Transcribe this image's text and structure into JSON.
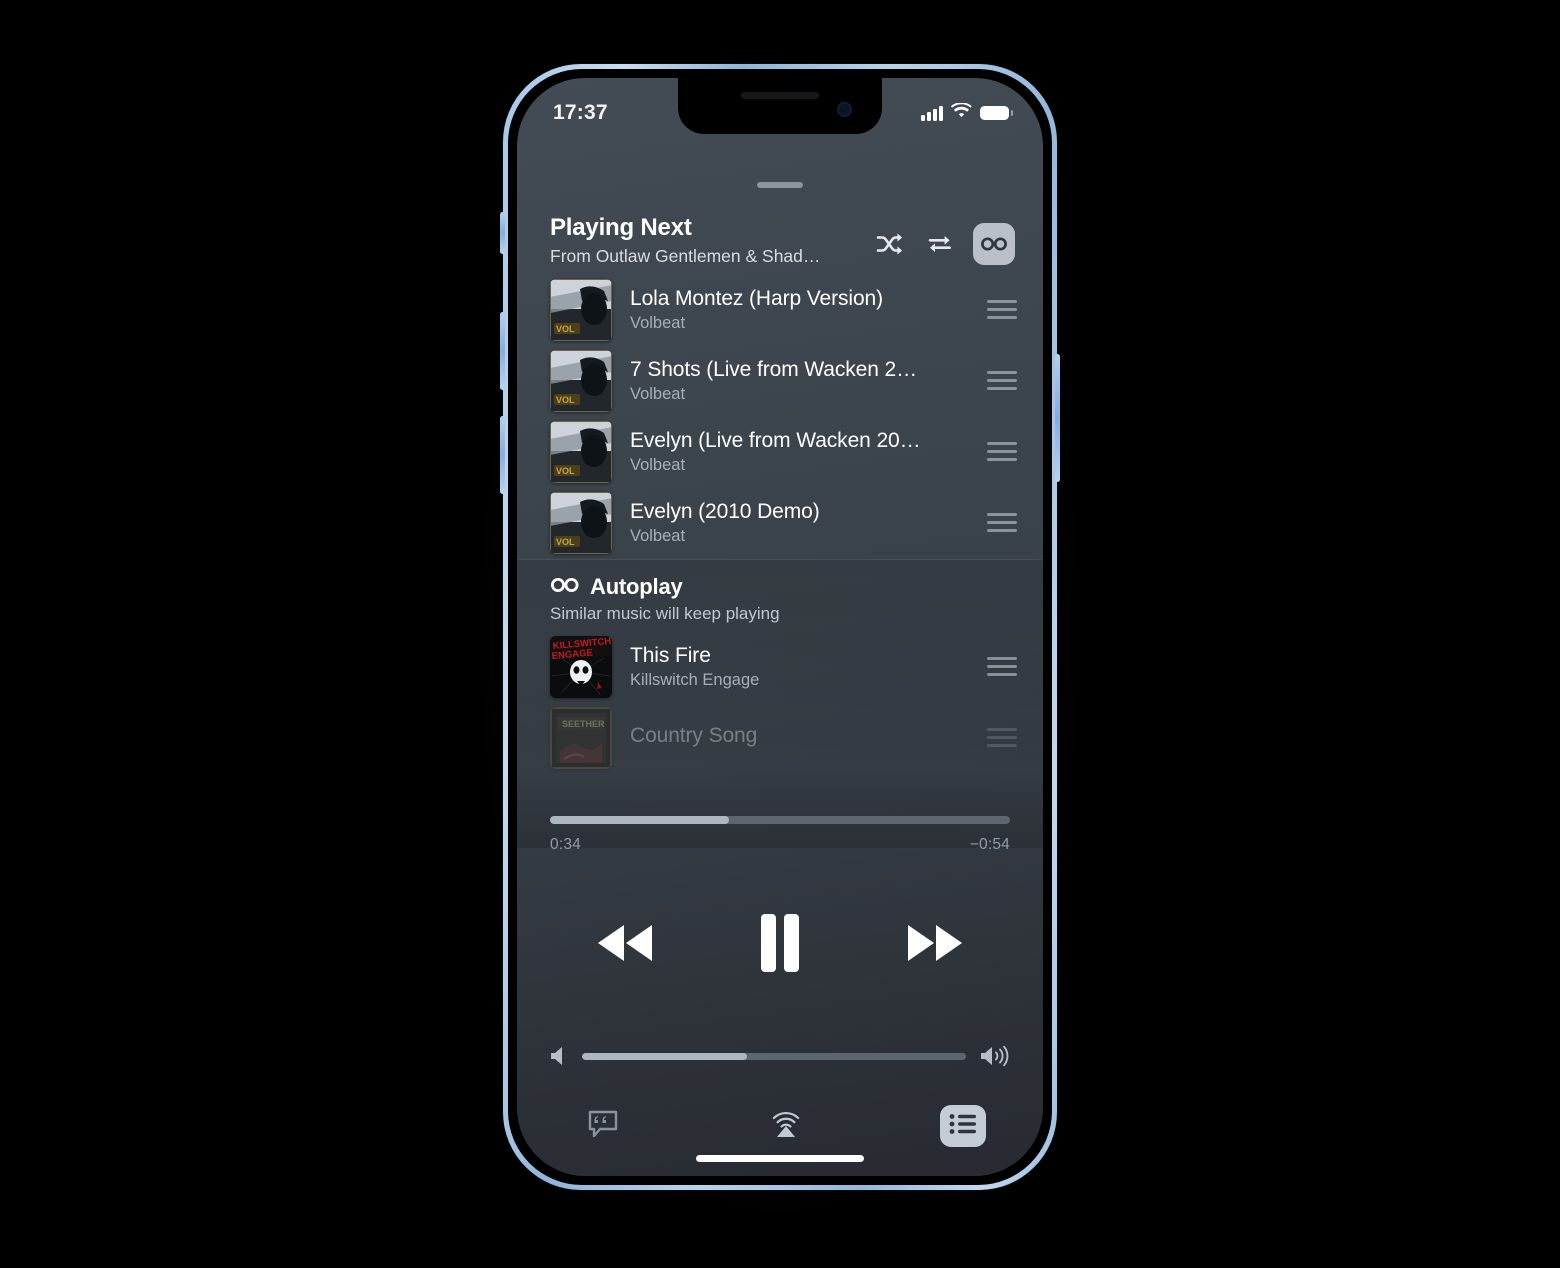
{
  "status_bar": {
    "time": "17:37",
    "signal_icon": "cellular-bars-icon",
    "wifi_icon": "wifi-icon",
    "battery_icon": "battery-icon"
  },
  "header": {
    "title": "Playing Next",
    "subtitle": "From Outlaw Gentlemen & Shady…",
    "shuffle_icon": "shuffle-icon",
    "repeat_icon": "repeat-icon",
    "autoplay_toggle_icon": "infinity-icon"
  },
  "queue": {
    "items": [
      {
        "title": "Lola Montez (Harp Version)",
        "artist": "Volbeat",
        "artwork": "volbeat-outlaw-gentlemen-cover"
      },
      {
        "title": "7 Shots (Live from Wacken 2…",
        "artist": "Volbeat",
        "artwork": "volbeat-outlaw-gentlemen-cover"
      },
      {
        "title": "Evelyn (Live from Wacken 20…",
        "artist": "Volbeat",
        "artwork": "volbeat-outlaw-gentlemen-cover"
      },
      {
        "title": "Evelyn (2010 Demo)",
        "artist": "Volbeat",
        "artwork": "volbeat-outlaw-gentlemen-cover"
      }
    ]
  },
  "autoplay": {
    "icon": "infinity-icon",
    "title": "Autoplay",
    "subtitle": "Similar music will keep playing",
    "items": [
      {
        "title": "This Fire",
        "artist": "Killswitch Engage",
        "artwork": "killswitch-engage-cover"
      },
      {
        "title": "Country Song",
        "artist": "",
        "artwork": "seether-cover"
      }
    ]
  },
  "player": {
    "elapsed": "0:34",
    "remaining": "−0:54",
    "progress_percent": 39,
    "volume_percent": 43,
    "rewind_icon": "rewind-icon",
    "pause_icon": "pause-icon",
    "fast_forward_icon": "fast-forward-icon",
    "volume_low_icon": "speaker-low-icon",
    "volume_high_icon": "speaker-high-icon"
  },
  "bottom_bar": {
    "lyrics_icon": "lyrics-icon",
    "airplay_icon": "airplay-icon",
    "queue_icon": "queue-list-icon"
  },
  "colors": {
    "screen_top": "#434b54",
    "screen_bottom": "#272b31",
    "accent_light": "#b9c0c8",
    "track_filled": "#aeb6bf",
    "track_empty": "#5d666f",
    "phone_rail": "#a6c6e8"
  }
}
